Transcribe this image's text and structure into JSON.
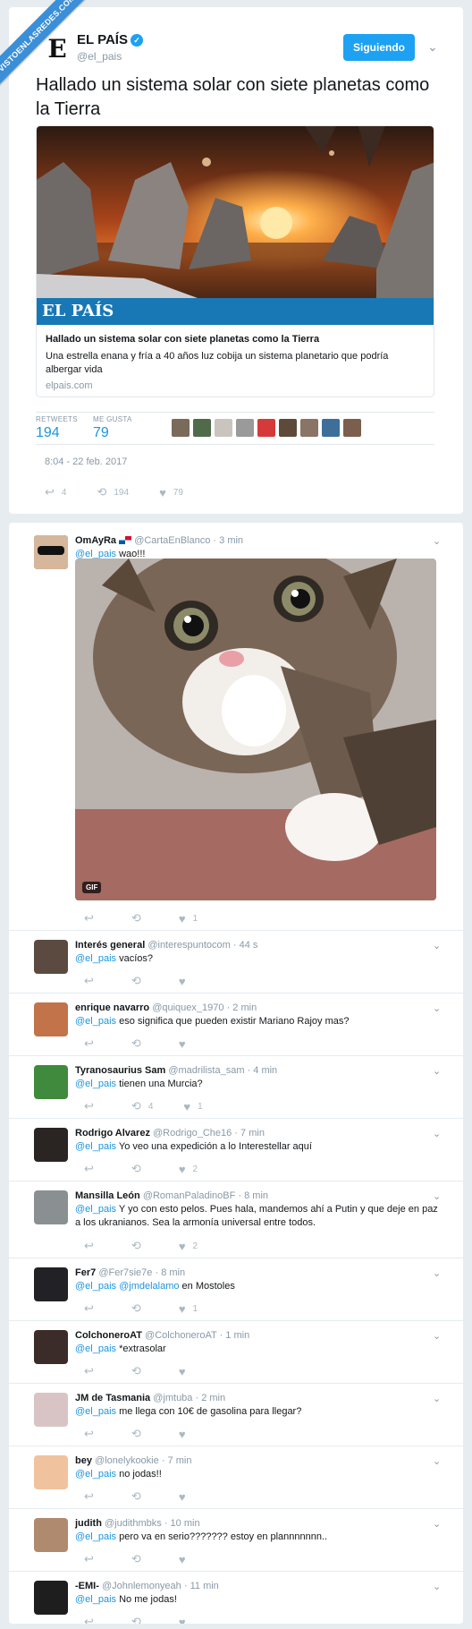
{
  "watermark": "VISTOENLASREDES.COM",
  "main_tweet": {
    "name": "EL PAÍS",
    "handle": "@el_pais",
    "follow_label": "Siguiendo",
    "text": "Hallado un sistema solar con siete planetas como la Tierra",
    "card": {
      "brand": "EL PAÍS",
      "title": "Hallado un sistema solar con siete planetas como la Tierra",
      "description": "Una estrella enana y fría a 40 años luz cobija un sistema planetario que podría albergar vida",
      "domain": "elpais.com"
    },
    "retweets_label": "RETWEETS",
    "retweets": "194",
    "likes_label": "ME GUSTA",
    "likes": "79",
    "timestamp": "8:04 - 22 feb. 2017",
    "action_replies": "4",
    "action_retweets": "194",
    "action_likes": "79"
  },
  "replies": [
    {
      "name": "OmAyRa",
      "handle": "@CartaEnBlanco",
      "time": "3 min",
      "mention": "@el_pais",
      "text": " wao!!!",
      "retweets": "",
      "likes": "1",
      "gif_label": "GIF"
    },
    {
      "name": "Interés general",
      "handle": "@interespuntocom",
      "time": "44 s",
      "mention": "@el_pais",
      "text": " vacíos?",
      "retweets": "",
      "likes": ""
    },
    {
      "name": "enrique navarro",
      "handle": "@quiquex_1970",
      "time": "2 min",
      "mention": "@el_pais",
      "text": " eso significa que pueden existir Mariano Rajoy mas?",
      "retweets": "",
      "likes": ""
    },
    {
      "name": "Tyranosaurius Sam",
      "handle": "@madrilista_sam",
      "time": "4 min",
      "mention": "@el_pais",
      "text": " tienen una Murcia?",
      "retweets": "4",
      "likes": "1"
    },
    {
      "name": "Rodrigo Alvarez",
      "handle": "@Rodrigo_Che16",
      "time": "7 min",
      "mention": "@el_pais",
      "text": " Yo veo una expedición a lo Interestellar aquí",
      "retweets": "",
      "likes": "2"
    },
    {
      "name": "Mansilla León",
      "handle": "@RomanPaladinoBF",
      "time": "8 min",
      "mention": "@el_pais",
      "text": " Y yo con esto pelos. Pues hala, mandemos ahí a Putin y que deje en paz a los ukranianos.  Sea la armonía universal entre todos.",
      "retweets": "",
      "likes": "2"
    },
    {
      "name": "Fer7",
      "handle": "@Fer7sie7e",
      "time": "8 min",
      "mention": "@el_pais",
      "mention2": "@jmdelalamo",
      "text": " en Mostoles",
      "retweets": "",
      "likes": "1"
    },
    {
      "name": "ColchoneroAT",
      "handle": "@ColchoneroAT",
      "time": "1 min",
      "mention": "@el_pais",
      "text": " *extrasolar",
      "retweets": "",
      "likes": ""
    },
    {
      "name": "JM de Tasmania",
      "handle": "@jmtuba",
      "time": "2 min",
      "mention": "@el_pais",
      "text": " me llega con 10€ de gasolina para llegar?",
      "retweets": "",
      "likes": ""
    },
    {
      "name": "bey",
      "handle": "@lonelykookie",
      "time": "7 min",
      "mention": "@el_pais",
      "text": " no jodas!!",
      "retweets": "",
      "likes": ""
    },
    {
      "name": "judith",
      "handle": "@judithmbks",
      "time": "10 min",
      "mention": "@el_pais",
      "text": " pero va en serio??????? estoy en plannnnnnn..",
      "retweets": "",
      "likes": ""
    },
    {
      "name": "-EMI-",
      "handle": "@Johnlemonyeah",
      "time": "11 min",
      "mention": "@el_pais",
      "text": " No me jodas!",
      "retweets": "",
      "likes": ""
    }
  ],
  "icons": {
    "reply": "reply-icon",
    "retweet": "retweet-icon",
    "like": "heart-icon",
    "more": "chevron-down-icon"
  },
  "colors": {
    "accent": "#1da1f2",
    "link": "#1b95e0",
    "brand_bar": "#1878b5",
    "muted": "#8899a6"
  }
}
